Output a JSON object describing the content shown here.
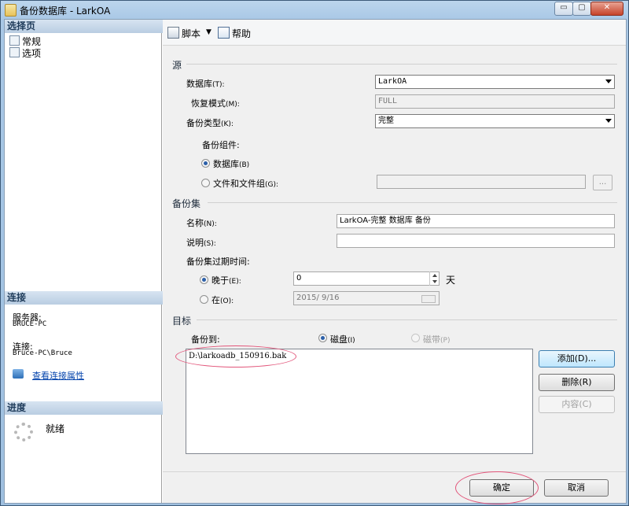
{
  "window": {
    "title": "备份数据库 - LarkOA",
    "min_glyph": "▭",
    "max_glyph": "▢",
    "close_glyph": "✕"
  },
  "left": {
    "select_page_header": "选择页",
    "pages": [
      "常规",
      "选项"
    ],
    "connection_header": "连接",
    "server_label": "服务器:",
    "server_value": "BRUCE-PC",
    "connection_label": "连接:",
    "connection_value": "Bruce-PC\\Bruce",
    "view_props_link": "查看连接属性",
    "progress_header": "进度",
    "progress_status": "就绪"
  },
  "toolbar": {
    "script_label": "脚本",
    "help_label": "帮助"
  },
  "source": {
    "group_label": "源",
    "database_label": "数据库",
    "database_key": "(T):",
    "database_value": "LarkOA",
    "recovery_label": "恢复模式",
    "recovery_key": "(M):",
    "recovery_value": "FULL",
    "backup_type_label": "备份类型",
    "backup_type_key": "(K):",
    "backup_type_value": "完整",
    "component_label": "备份组件:",
    "radio_database": "数据库",
    "radio_database_key": "(B)",
    "radio_files": "文件和文件组",
    "radio_files_key": "(G):",
    "browse_glyph": "..."
  },
  "backupset": {
    "group_label": "备份集",
    "name_label": "名称",
    "name_key": "(N):",
    "name_value": "LarkOA-完整 数据库 备份",
    "desc_label": "说明",
    "desc_key": "(S):",
    "desc_value": "",
    "expire_label": "备份集过期时间:",
    "after_label": "晚于",
    "after_key": "(E):",
    "after_value": "0",
    "after_unit": "天",
    "on_label": "在",
    "on_key": "(O):",
    "on_value": "2015/ 9/16"
  },
  "destination": {
    "group_label": "目标",
    "backup_to_label": "备份到:",
    "disk_label": "磁盘",
    "disk_key": "(I)",
    "tape_label": "磁带",
    "tape_key": "(P)",
    "files": [
      "D:\\larkoadb_150916.bak"
    ],
    "add_button": "添加(D)...",
    "remove_button": "删除(R)",
    "contents_button": "内容(C)"
  },
  "footer": {
    "ok_button": "确定",
    "cancel_button": "取消"
  },
  "colors": {
    "highlight_ellipse": "#e2557a",
    "link": "#0645ad"
  }
}
